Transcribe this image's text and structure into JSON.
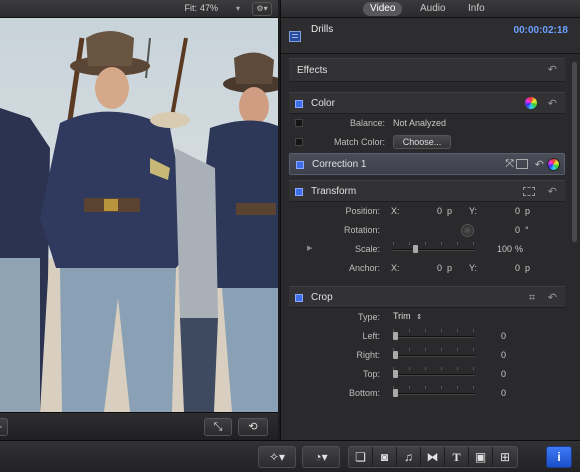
{
  "viewer": {
    "fit_label": "Fit:",
    "fit_value": "47%"
  },
  "inspector": {
    "tabs": [
      "Video",
      "Audio",
      "Info"
    ],
    "active_tab": "Video",
    "clip_name": "Drills",
    "timecode": "00:00:02:18",
    "effects_label": "Effects",
    "color": {
      "label": "Color",
      "balance_label": "Balance:",
      "balance_value": "Not Analyzed",
      "match_color_label": "Match Color:",
      "choose_button": "Choose...",
      "correction_label": "Correction 1"
    },
    "transform": {
      "label": "Transform",
      "position_label": "Position:",
      "position_x_label": "X:",
      "position_x": "0",
      "position_x_unit": "p",
      "position_y_label": "Y:",
      "position_y": "0",
      "position_y_unit": "p",
      "rotation_label": "Rotation:",
      "rotation_value": "0",
      "rotation_unit": "°",
      "scale_label": "Scale:",
      "scale_value": "100",
      "scale_unit": "%",
      "anchor_label": "Anchor:",
      "anchor_x_label": "X:",
      "anchor_x": "0",
      "anchor_x_unit": "p",
      "anchor_y_label": "Y:",
      "anchor_y": "0",
      "anchor_y_unit": "p"
    },
    "crop": {
      "label": "Crop",
      "type_label": "Type:",
      "type_value": "Trim",
      "left_label": "Left:",
      "left_value": "0",
      "right_label": "Right:",
      "right_value": "0",
      "top_label": "Top:",
      "top_value": "0",
      "bottom_label": "Bottom:",
      "bottom_value": "0"
    }
  },
  "toolbar": {
    "tools": [
      "magic-wand-icon",
      "retime-icon",
      "browser-icon",
      "photos-icon",
      "music-icon",
      "transitions-icon",
      "titles-icon",
      "generators-icon",
      "themes-icon",
      "inspector-info-icon"
    ]
  },
  "colors": {
    "accent_blue": "#3e6ee8",
    "timecode_blue": "#6ea0ff",
    "panel_bg": "#2a2a2c"
  }
}
